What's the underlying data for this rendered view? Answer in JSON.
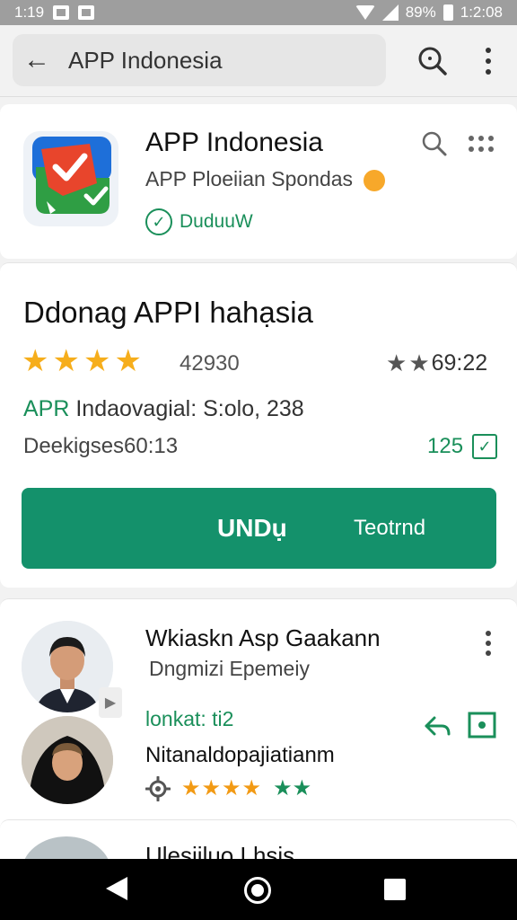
{
  "status_bar": {
    "time_left": "1:19",
    "battery": "89%",
    "time_right": "1:2:08"
  },
  "search": {
    "query": "APP Indonesia"
  },
  "app": {
    "name": "APP Indonesia",
    "subtitle": "APP Ploeiian Spondas",
    "verified_label": "DuduuW"
  },
  "details": {
    "title": "Ddonag APPI hahạsia",
    "stars": [
      "★",
      "★",
      "★",
      "★"
    ],
    "rating_count": "42930",
    "right_rating": "69:22",
    "info_prefix": "APR",
    "info_rest": " Indaovagial: S:olo, 238",
    "downloads": "Deekigses60:13",
    "download_count": "125",
    "install_label": "UNDụ",
    "secondary_label": "Teotrnd"
  },
  "review": {
    "name": "Wkiaskn Asp Gaakann",
    "subtitle": "Dngmizi Epemeiy",
    "status": "lonkat: ti2",
    "name2": "Nitanaldopajiatianm",
    "orange_stars": "★★★★",
    "green_stars": "★★"
  },
  "next": {
    "title": "Ulesiiluo Lhsis"
  },
  "colors": {
    "accent_green": "#14916b",
    "star_orange": "#f6ae1c"
  }
}
